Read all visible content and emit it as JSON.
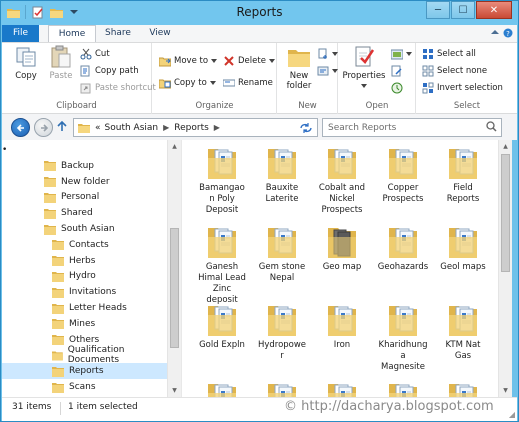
{
  "window": {
    "title": "Reports",
    "controls": {
      "minimize": "─",
      "maximize": "☐",
      "close": "✕"
    }
  },
  "ribbon": {
    "tabs": {
      "file": "File",
      "home": "Home",
      "share": "Share",
      "view": "View"
    },
    "clipboard": {
      "label": "Clipboard",
      "copy": "Copy",
      "paste": "Paste",
      "cut": "Cut",
      "copy_path": "Copy path",
      "paste_shortcut": "Paste shortcut"
    },
    "organize": {
      "label": "Organize",
      "move_to": "Move to",
      "copy_to": "Copy to",
      "delete": "Delete",
      "rename": "Rename"
    },
    "new": {
      "label": "New",
      "new_folder_line1": "New",
      "new_folder_line2": "folder"
    },
    "open": {
      "label": "Open",
      "properties": "Properties"
    },
    "select": {
      "label": "Select",
      "select_all": "Select all",
      "select_none": "Select none",
      "invert_selection": "Invert selection"
    },
    "accent_color": "#1979ca"
  },
  "address": {
    "overflow": "«",
    "crumbs": [
      "South Asian",
      "Reports"
    ],
    "search_placeholder": "Search Reports"
  },
  "nav_pane": {
    "items": [
      {
        "label": "•"
      },
      {
        "label": "Backup"
      },
      {
        "label": "New folder"
      },
      {
        "label": "Personal"
      },
      {
        "label": "Shared"
      },
      {
        "label": "South Asian"
      },
      {
        "label": "Contacts"
      },
      {
        "label": "Herbs"
      },
      {
        "label": "Hydro"
      },
      {
        "label": "Invitations"
      },
      {
        "label": "Letter Heads"
      },
      {
        "label": "Mines"
      },
      {
        "label": "Others"
      },
      {
        "label": "Qualification Documents"
      },
      {
        "label": "Reports"
      },
      {
        "label": "Scans"
      }
    ]
  },
  "files": [
    {
      "label": "Bamangaon Poly Deposit",
      "lines": [
        "Bamangao",
        "n Poly",
        "Deposit"
      ],
      "kind": "docs"
    },
    {
      "label": "Bauxite Laterite",
      "lines": [
        "Bauxite",
        "Laterite"
      ],
      "kind": "docs"
    },
    {
      "label": "Cobalt and Nickel Prospects",
      "lines": [
        "Cobalt and",
        "Nickel",
        "Prospects"
      ],
      "kind": "docs"
    },
    {
      "label": "Copper Prospects",
      "lines": [
        "Copper",
        "Prospects"
      ],
      "kind": "docs"
    },
    {
      "label": "Field Reports",
      "lines": [
        "Field",
        "Reports"
      ],
      "kind": "docs"
    },
    {
      "label": "Ganesh Himal Lead Zinc deposit",
      "lines": [
        "Ganesh",
        "Himal Lead",
        "Zinc",
        "deposit"
      ],
      "kind": "docs"
    },
    {
      "label": "Gem stone Nepal",
      "lines": [
        "Gem stone",
        "Nepal"
      ],
      "kind": "docs"
    },
    {
      "label": "Geo map",
      "lines": [
        "Geo map"
      ],
      "kind": "dark"
    },
    {
      "label": "Geohazards",
      "lines": [
        "Geohazards"
      ],
      "kind": "docs"
    },
    {
      "label": "Geol maps",
      "lines": [
        "Geol maps"
      ],
      "kind": "docs"
    },
    {
      "label": "Gold Expln",
      "lines": [
        "Gold Expln"
      ],
      "kind": "docs"
    },
    {
      "label": "Hydropower",
      "lines": [
        "Hydropowe",
        "r"
      ],
      "kind": "docs"
    },
    {
      "label": "Iron",
      "lines": [
        "Iron"
      ],
      "kind": "docs"
    },
    {
      "label": "Kharidhunga Magnesite",
      "lines": [
        "Kharidhung",
        "a",
        "Magnesite"
      ],
      "kind": "docs"
    },
    {
      "label": "KTM Nat Gas",
      "lines": [
        "KTM Nat",
        "Gas"
      ],
      "kind": "docs"
    },
    {
      "label": "",
      "lines": [],
      "kind": "docs"
    },
    {
      "label": "",
      "lines": [],
      "kind": "docs"
    },
    {
      "label": "",
      "lines": [],
      "kind": "docs"
    },
    {
      "label": "",
      "lines": [],
      "kind": "docs"
    },
    {
      "label": "",
      "lines": [],
      "kind": "docs"
    }
  ],
  "status": {
    "item_count": "31 items",
    "selection": "1 item selected",
    "watermark": "© http://dacharya.blogspot.com"
  },
  "colors": {
    "folder_body": "#f3d37a",
    "folder_back": "#e0b54c",
    "selection": "#cde8ff",
    "title_bar": "#72c6ee"
  }
}
